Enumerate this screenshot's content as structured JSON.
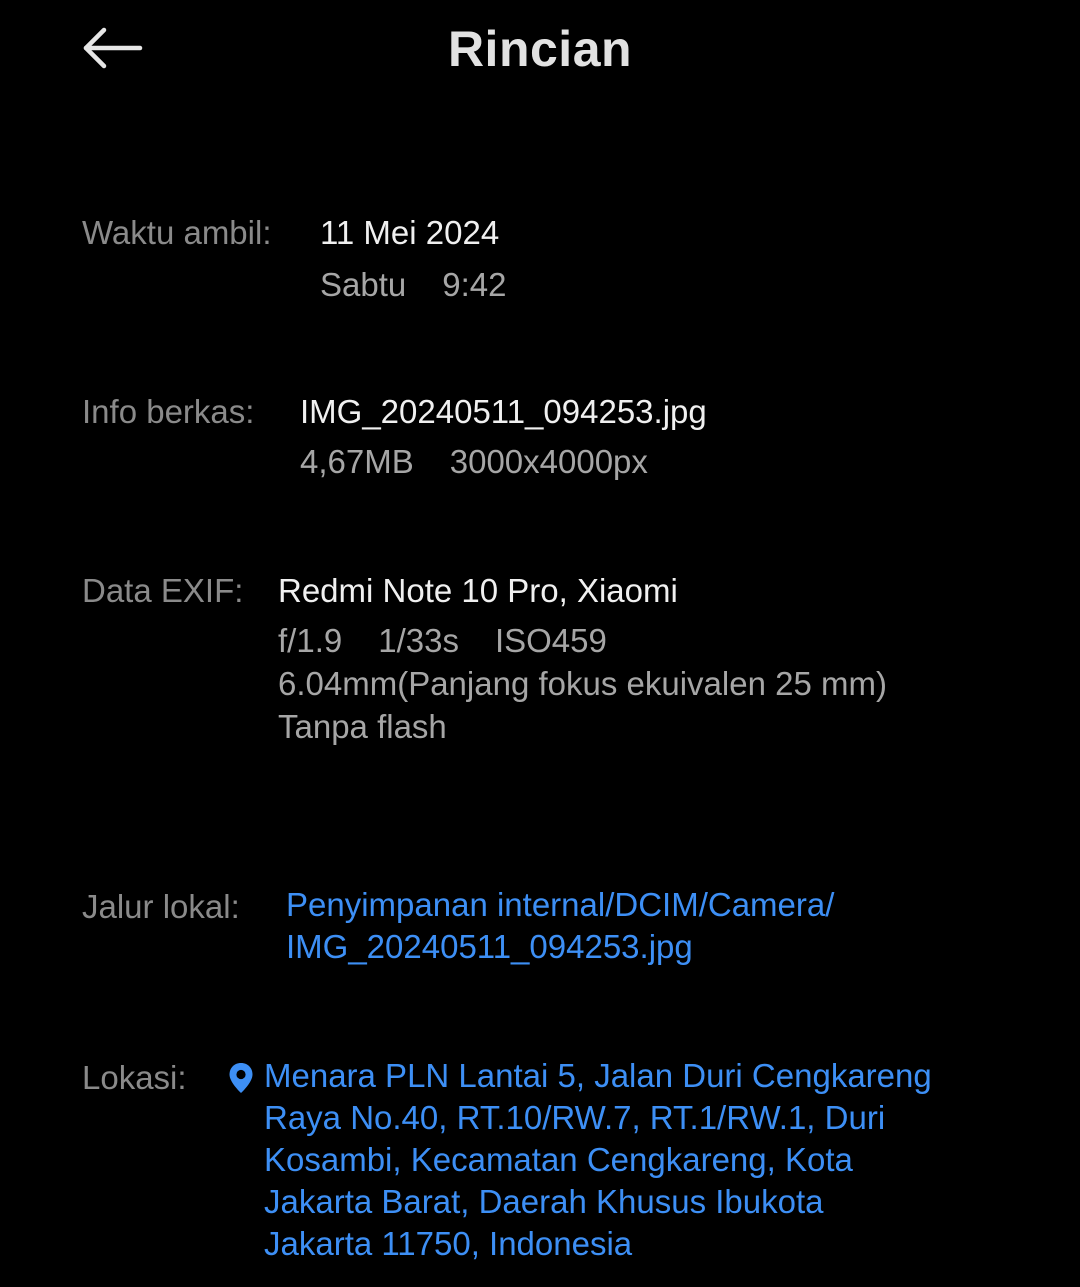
{
  "header": {
    "title": "Rincian"
  },
  "capture_time": {
    "label": "Waktu ambil:",
    "date": "11 Mei 2024",
    "day": "Sabtu",
    "time": "9:42"
  },
  "file_info": {
    "label": "Info berkas:",
    "filename": "IMG_20240511_094253.jpg",
    "size": "4,67MB",
    "resolution": "3000x4000px"
  },
  "exif": {
    "label": "Data EXIF:",
    "device": "Redmi Note 10 Pro, Xiaomi",
    "aperture": "f/1.9",
    "shutter": "1/33s",
    "iso": "ISO459",
    "focal": "6.04mm(Panjang fokus ekuivalen 25 mm)",
    "flash": "Tanpa flash"
  },
  "local_path": {
    "label": "Jalur lokal:",
    "line1": "Penyimpanan internal/DCIM/Camera/",
    "line2": "IMG_20240511_094253.jpg"
  },
  "location": {
    "label": "Lokasi:",
    "icon": "location-pin-icon",
    "lines": [
      "Menara PLN Lantai 5, Jalan Duri Cengkareng",
      "Raya No.40, RT.10/RW.7, RT.1/RW.1, Duri",
      "Kosambi, Kecamatan Cengkareng, Kota",
      "Jakarta Barat, Daerah Khusus Ibukota",
      "Jakarta 11750, Indonesia"
    ]
  },
  "colors": {
    "background": "#000000",
    "label": "#8a8a8a",
    "primary_text": "#f0f0f0",
    "secondary_text": "#a6a6a6",
    "link": "#3d8ff5"
  }
}
